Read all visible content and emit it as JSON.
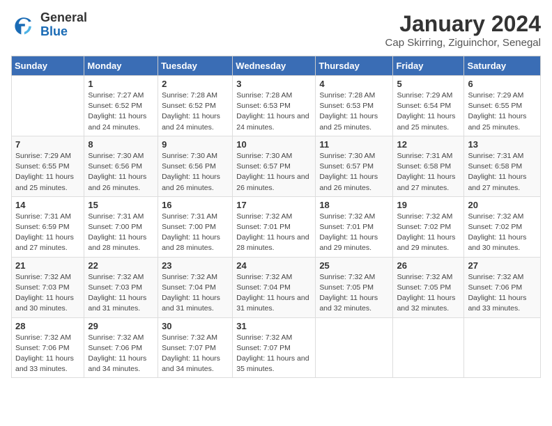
{
  "logo": {
    "general": "General",
    "blue": "Blue"
  },
  "title": "January 2024",
  "subtitle": "Cap Skirring, Ziguinchor, Senegal",
  "days_of_week": [
    "Sunday",
    "Monday",
    "Tuesday",
    "Wednesday",
    "Thursday",
    "Friday",
    "Saturday"
  ],
  "weeks": [
    [
      {
        "day": "",
        "detail": ""
      },
      {
        "day": "1",
        "detail": "Sunrise: 7:27 AM\nSunset: 6:52 PM\nDaylight: 11 hours and 24 minutes."
      },
      {
        "day": "2",
        "detail": "Sunrise: 7:28 AM\nSunset: 6:52 PM\nDaylight: 11 hours and 24 minutes."
      },
      {
        "day": "3",
        "detail": "Sunrise: 7:28 AM\nSunset: 6:53 PM\nDaylight: 11 hours and 24 minutes."
      },
      {
        "day": "4",
        "detail": "Sunrise: 7:28 AM\nSunset: 6:53 PM\nDaylight: 11 hours and 25 minutes."
      },
      {
        "day": "5",
        "detail": "Sunrise: 7:29 AM\nSunset: 6:54 PM\nDaylight: 11 hours and 25 minutes."
      },
      {
        "day": "6",
        "detail": "Sunrise: 7:29 AM\nSunset: 6:55 PM\nDaylight: 11 hours and 25 minutes."
      }
    ],
    [
      {
        "day": "7",
        "detail": "Sunrise: 7:29 AM\nSunset: 6:55 PM\nDaylight: 11 hours and 25 minutes."
      },
      {
        "day": "8",
        "detail": "Sunrise: 7:30 AM\nSunset: 6:56 PM\nDaylight: 11 hours and 26 minutes."
      },
      {
        "day": "9",
        "detail": "Sunrise: 7:30 AM\nSunset: 6:56 PM\nDaylight: 11 hours and 26 minutes."
      },
      {
        "day": "10",
        "detail": "Sunrise: 7:30 AM\nSunset: 6:57 PM\nDaylight: 11 hours and 26 minutes."
      },
      {
        "day": "11",
        "detail": "Sunrise: 7:30 AM\nSunset: 6:57 PM\nDaylight: 11 hours and 26 minutes."
      },
      {
        "day": "12",
        "detail": "Sunrise: 7:31 AM\nSunset: 6:58 PM\nDaylight: 11 hours and 27 minutes."
      },
      {
        "day": "13",
        "detail": "Sunrise: 7:31 AM\nSunset: 6:58 PM\nDaylight: 11 hours and 27 minutes."
      }
    ],
    [
      {
        "day": "14",
        "detail": "Sunrise: 7:31 AM\nSunset: 6:59 PM\nDaylight: 11 hours and 27 minutes."
      },
      {
        "day": "15",
        "detail": "Sunrise: 7:31 AM\nSunset: 7:00 PM\nDaylight: 11 hours and 28 minutes."
      },
      {
        "day": "16",
        "detail": "Sunrise: 7:31 AM\nSunset: 7:00 PM\nDaylight: 11 hours and 28 minutes."
      },
      {
        "day": "17",
        "detail": "Sunrise: 7:32 AM\nSunset: 7:01 PM\nDaylight: 11 hours and 28 minutes."
      },
      {
        "day": "18",
        "detail": "Sunrise: 7:32 AM\nSunset: 7:01 PM\nDaylight: 11 hours and 29 minutes."
      },
      {
        "day": "19",
        "detail": "Sunrise: 7:32 AM\nSunset: 7:02 PM\nDaylight: 11 hours and 29 minutes."
      },
      {
        "day": "20",
        "detail": "Sunrise: 7:32 AM\nSunset: 7:02 PM\nDaylight: 11 hours and 30 minutes."
      }
    ],
    [
      {
        "day": "21",
        "detail": "Sunrise: 7:32 AM\nSunset: 7:03 PM\nDaylight: 11 hours and 30 minutes."
      },
      {
        "day": "22",
        "detail": "Sunrise: 7:32 AM\nSunset: 7:03 PM\nDaylight: 11 hours and 31 minutes."
      },
      {
        "day": "23",
        "detail": "Sunrise: 7:32 AM\nSunset: 7:04 PM\nDaylight: 11 hours and 31 minutes."
      },
      {
        "day": "24",
        "detail": "Sunrise: 7:32 AM\nSunset: 7:04 PM\nDaylight: 11 hours and 31 minutes."
      },
      {
        "day": "25",
        "detail": "Sunrise: 7:32 AM\nSunset: 7:05 PM\nDaylight: 11 hours and 32 minutes."
      },
      {
        "day": "26",
        "detail": "Sunrise: 7:32 AM\nSunset: 7:05 PM\nDaylight: 11 hours and 32 minutes."
      },
      {
        "day": "27",
        "detail": "Sunrise: 7:32 AM\nSunset: 7:06 PM\nDaylight: 11 hours and 33 minutes."
      }
    ],
    [
      {
        "day": "28",
        "detail": "Sunrise: 7:32 AM\nSunset: 7:06 PM\nDaylight: 11 hours and 33 minutes."
      },
      {
        "day": "29",
        "detail": "Sunrise: 7:32 AM\nSunset: 7:06 PM\nDaylight: 11 hours and 34 minutes."
      },
      {
        "day": "30",
        "detail": "Sunrise: 7:32 AM\nSunset: 7:07 PM\nDaylight: 11 hours and 34 minutes."
      },
      {
        "day": "31",
        "detail": "Sunrise: 7:32 AM\nSunset: 7:07 PM\nDaylight: 11 hours and 35 minutes."
      },
      {
        "day": "",
        "detail": ""
      },
      {
        "day": "",
        "detail": ""
      },
      {
        "day": "",
        "detail": ""
      }
    ]
  ]
}
